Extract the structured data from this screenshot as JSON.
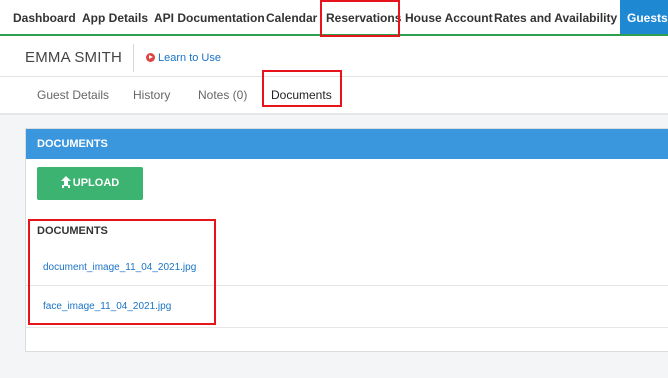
{
  "nav": {
    "items": [
      {
        "label": "Dashboard"
      },
      {
        "label": "App Details"
      },
      {
        "label": "API Documentation"
      },
      {
        "label": "Calendar"
      },
      {
        "label": "Reservations"
      },
      {
        "label": "House Account"
      },
      {
        "label": "Rates and Availability"
      },
      {
        "label": "Guests",
        "active": true
      }
    ]
  },
  "guest": {
    "name": "EMMA SMITH",
    "learn_label": "Learn to Use"
  },
  "subtabs": [
    {
      "label": "Guest Details"
    },
    {
      "label": "History"
    },
    {
      "label": "Notes (0)"
    },
    {
      "label": "Documents",
      "active": true
    }
  ],
  "documents_panel": {
    "header": "DOCUMENTS",
    "upload_label": "UPLOAD",
    "list_title": "DOCUMENTS",
    "files": [
      {
        "name": "document_image_11_04_2021.jpg"
      },
      {
        "name": "face_image_11_04_2021.jpg"
      }
    ]
  },
  "colors": {
    "accent_blue": "#1e88d3",
    "panel_header": "#3a96dd",
    "upload_green": "#3cb371",
    "nav_border_green": "#2e9e4f",
    "highlight_red": "#e8141c",
    "link_blue": "#1a73c7"
  }
}
